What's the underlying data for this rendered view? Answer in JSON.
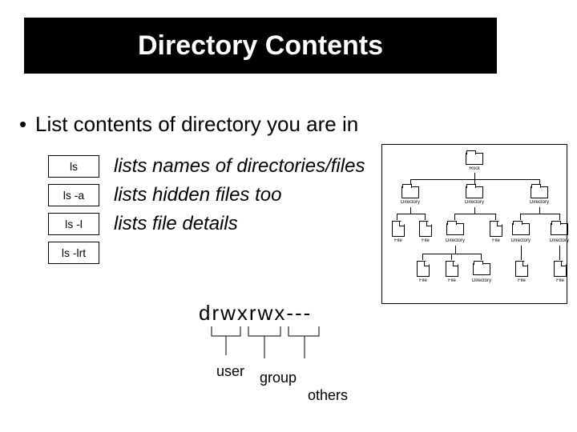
{
  "title": "Directory Contents",
  "bullet": "List contents of directory you are in",
  "commands": [
    {
      "cmd": "ls",
      "desc": "lists names of directories/files"
    },
    {
      "cmd": "ls  -a",
      "desc": "lists hidden files too"
    },
    {
      "cmd": "ls  -l",
      "desc": "lists file details"
    },
    {
      "cmd": "ls  -lrt",
      "desc": ""
    }
  ],
  "perm_string": "drwxrwx---",
  "perm_labels": {
    "user": "user",
    "group": "group",
    "others": "others"
  },
  "tree": {
    "root_label": "Root",
    "row2": [
      "Directory",
      "Directory",
      "Directory"
    ],
    "row3": [
      "File",
      "File",
      "Directory",
      "File",
      "Directory",
      "Directory"
    ],
    "row4": [
      "File",
      "File",
      "Directory",
      "File",
      "File"
    ]
  }
}
